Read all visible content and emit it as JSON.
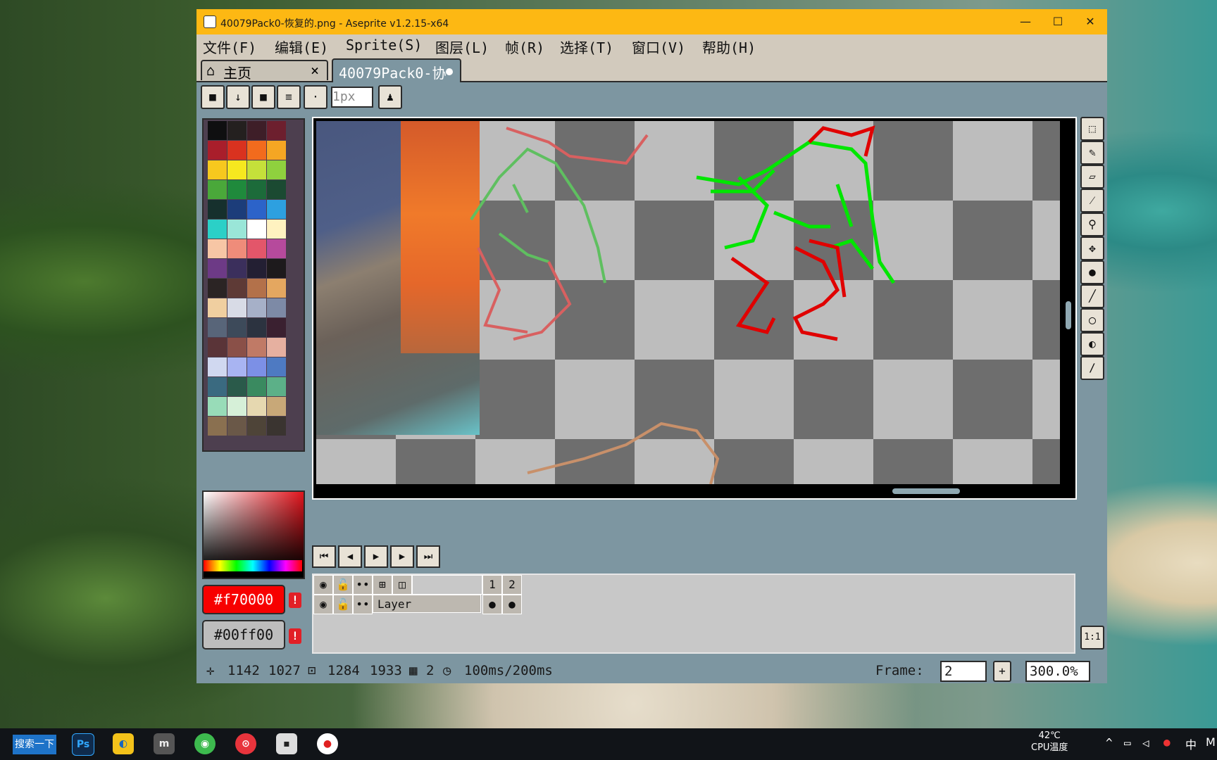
{
  "window": {
    "title": "40079Pack0-恢复的.png - Aseprite v1.2.15-x64",
    "minimize": "—",
    "maximize": "☐",
    "close": "✕"
  },
  "menu": [
    "文件(F)",
    "编辑(E)",
    "Sprite(S)",
    "图层(L)",
    "帧(R)",
    "选择(T)",
    "窗口(V)",
    "帮助(H)"
  ],
  "tabs": {
    "home_label": "主页",
    "home_close": "×",
    "doc_label": "40079Pack0-协"
  },
  "toolbar": {
    "brush_size": "1px"
  },
  "colors": {
    "foreground": "#f70000",
    "background": "#00ff00",
    "warn": "!"
  },
  "timeline": {
    "frame1": "1",
    "frame2": "2",
    "layer_name": "Layer",
    "ratio": "1:1"
  },
  "status": {
    "cursor_x": "1142",
    "cursor_y": "1027",
    "size_w": "1284",
    "size_h": "1933",
    "frames": "2",
    "duration": "100ms/200ms",
    "frame_label": "Frame:",
    "frame_value": "2",
    "plus": "+",
    "zoom": "300.0%"
  },
  "taskbar": {
    "search": "搜索一下",
    "ps": "Ps",
    "temp": "42℃",
    "temp_label": "CPU温度",
    "ime": "中",
    "corner": "M"
  },
  "palette_colors": [
    "#0f0f10",
    "#24201f",
    "#3e1e28",
    "#6d1f2e",
    "#a91e2b",
    "#d9321f",
    "#f26b1d",
    "#f5a623",
    "#f7c81e",
    "#f6e81f",
    "#c5e03a",
    "#8fd13e",
    "#4aa83a",
    "#1f8a3c",
    "#1c6b3a",
    "#1b4a32",
    "#16302d",
    "#1c3d7a",
    "#2c63c9",
    "#2da0e0",
    "#2bd0c7",
    "#9ae6d8",
    "#ffffff",
    "#fff2c0",
    "#f7c6a5",
    "#ef8c7a",
    "#e3566a",
    "#b64a9c",
    "#6d3a86",
    "#3b2f5c",
    "#231f33",
    "#1d1a1c",
    "#2b2424",
    "#5e3a36",
    "#b3714a",
    "#e4a760",
    "#f0cfa0",
    "#d8dbe6",
    "#a6b0c8",
    "#7d8aa6",
    "#586579",
    "#3d4a5a",
    "#2c3340",
    "#3a2030",
    "#5a3438",
    "#8a5048",
    "#c07a66",
    "#e6b0a0",
    "#d0d8f0",
    "#a8b4f2",
    "#7c90e6",
    "#4e7ac2",
    "#3a6a80",
    "#2a5a4a",
    "#3a8a60",
    "#5cb088",
    "#98dcb8",
    "#d6f0d8",
    "#e6d8b0",
    "#c8a878",
    "#8a7050",
    "#6a5848",
    "#4e4438",
    "#3a3430"
  ]
}
